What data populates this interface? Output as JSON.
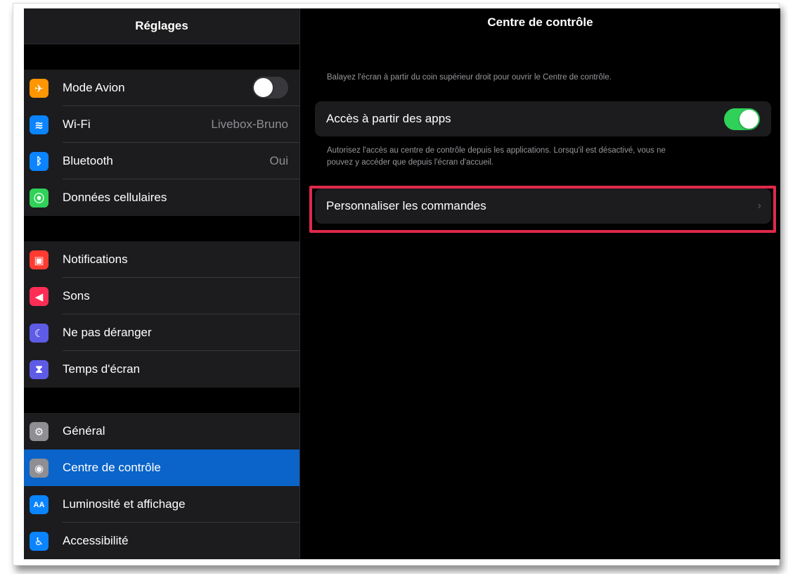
{
  "sidebar": {
    "title": "Réglages",
    "groups": [
      [
        {
          "label": "Mode Avion",
          "icon": "airplane-icon",
          "color": "#ff9500",
          "glyph": "✈",
          "toggle": "off"
        },
        {
          "label": "Wi-Fi",
          "icon": "wifi-icon",
          "color": "#0a84ff",
          "glyph": "≋",
          "value": "Livebox-Bruno"
        },
        {
          "label": "Bluetooth",
          "icon": "bluetooth-icon",
          "color": "#0a84ff",
          "glyph": "ᛒ",
          "value": "Oui"
        },
        {
          "label": "Données cellulaires",
          "icon": "cellular-icon",
          "color": "#30d158",
          "glyph": "⦿"
        }
      ],
      [
        {
          "label": "Notifications",
          "icon": "notifications-icon",
          "color": "#ff3b30",
          "glyph": "▣"
        },
        {
          "label": "Sons",
          "icon": "sound-icon",
          "color": "#ff2d55",
          "glyph": "◀"
        },
        {
          "label": "Ne pas déranger",
          "icon": "moon-icon",
          "color": "#5e5ce6",
          "glyph": "☾"
        },
        {
          "label": "Temps d'écran",
          "icon": "hourglass-icon",
          "color": "#5e5ce6",
          "glyph": "⧗"
        }
      ],
      [
        {
          "label": "Général",
          "icon": "gear-icon",
          "color": "#8e8e93",
          "glyph": "⚙"
        },
        {
          "label": "Centre de contrôle",
          "icon": "control-center-icon",
          "color": "#8e8e93",
          "glyph": "◉",
          "selected": true
        },
        {
          "label": "Luminosité et affichage",
          "icon": "display-icon",
          "color": "#0a84ff",
          "glyph": "AA"
        },
        {
          "label": "Accessibilité",
          "icon": "accessibility-icon",
          "color": "#0a84ff",
          "glyph": "♿"
        }
      ]
    ]
  },
  "detail": {
    "title": "Centre de contrôle",
    "top_hint": "Balayez l'écran à partir du coin supérieur droit pour ouvrir le Centre de contrôle.",
    "access_label": "Accès à partir des apps",
    "access_toggle": "on",
    "access_footer_line1": "Autorisez l'accès au centre de contrôle depuis les applications. Lorsqu'il est désactivé, vous ne",
    "access_footer_line2": "pouvez y accéder que depuis l'écran d'accueil.",
    "customize_label": "Personnaliser les commandes",
    "chevron": "›"
  },
  "colors": {
    "selected": "#0a64c9",
    "toggle_on": "#30d158",
    "highlight": "#e0294a"
  }
}
